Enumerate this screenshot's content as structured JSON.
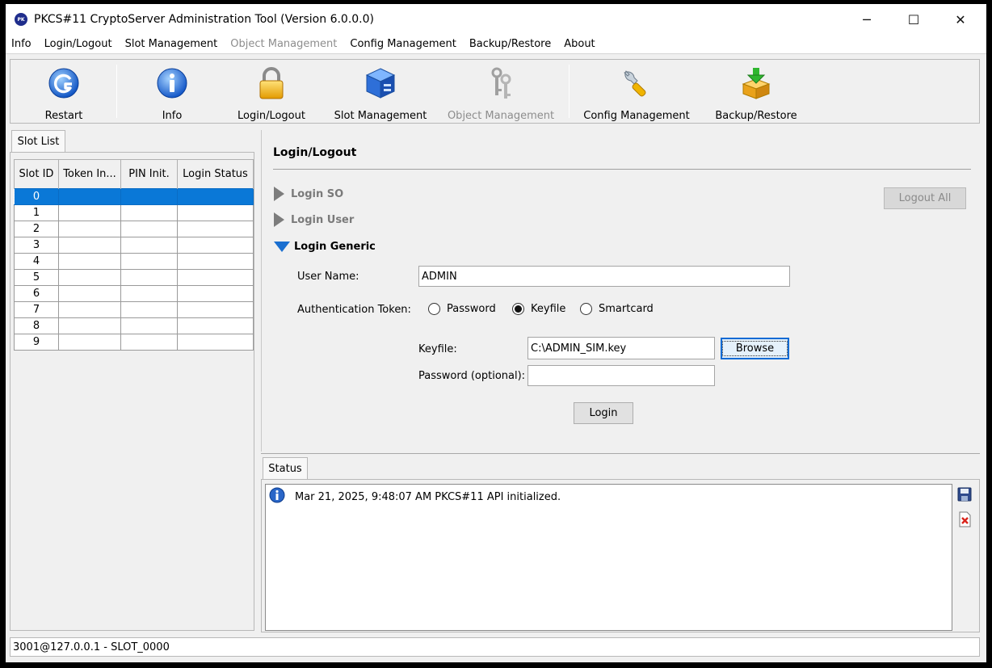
{
  "window": {
    "title": "PKCS#11 CryptoServer Administration Tool (Version 6.0.0.0)",
    "app_icon_text": "PK",
    "minimize": "─",
    "maximize": "☐",
    "close": "✕"
  },
  "menu": [
    {
      "label": "Info",
      "disabled": false
    },
    {
      "label": "Login/Logout",
      "disabled": false
    },
    {
      "label": "Slot Management",
      "disabled": false
    },
    {
      "label": "Object Management",
      "disabled": true
    },
    {
      "label": "Config Management",
      "disabled": false
    },
    {
      "label": "Backup/Restore",
      "disabled": false
    },
    {
      "label": "About",
      "disabled": false
    }
  ],
  "toolbar": {
    "restart": "Restart",
    "info": "Info",
    "login_logout": "Login/Logout",
    "slot_management": "Slot Management",
    "object_management": "Object Management",
    "config_management": "Config Management",
    "backup_restore": "Backup/Restore"
  },
  "slot_list": {
    "tab": "Slot List",
    "columns": [
      "Slot ID",
      "Token In...",
      "PIN Init.",
      "Login Status"
    ],
    "rows": [
      "0",
      "1",
      "2",
      "3",
      "4",
      "5",
      "6",
      "7",
      "8",
      "9"
    ],
    "selected": "0"
  },
  "login": {
    "title": "Login/Logout",
    "sections": {
      "so": "Login SO",
      "user": "Login User",
      "generic": "Login Generic"
    },
    "logout_all": "Logout All",
    "user_name_label": "User Name:",
    "user_name_value": "ADMIN",
    "auth_token_label": "Authentication Token:",
    "auth_options": [
      "Password",
      "Keyfile",
      "Smartcard"
    ],
    "auth_selected": "Keyfile",
    "keyfile_label": "Keyfile:",
    "keyfile_value": "C:\\ADMIN_SIM.key",
    "browse": "Browse",
    "password_label": "Password (optional):",
    "password_value": "",
    "login_button": "Login"
  },
  "status": {
    "tab": "Status",
    "message": "Mar 21, 2025, 9:48:07 AM  PKCS#11 API initialized."
  },
  "statusbar": {
    "text": "3001@127.0.0.1 - SLOT_0000"
  },
  "icons": {
    "restart": "restart-icon",
    "info": "info-icon",
    "lock": "lock-icon",
    "slot": "server-icon",
    "keys": "keys-icon",
    "wrench": "wrench-icon",
    "backup": "box-download-icon"
  },
  "colors": {
    "selection": "#0a78d7",
    "section_open_arrow": "#1a6fd0"
  }
}
